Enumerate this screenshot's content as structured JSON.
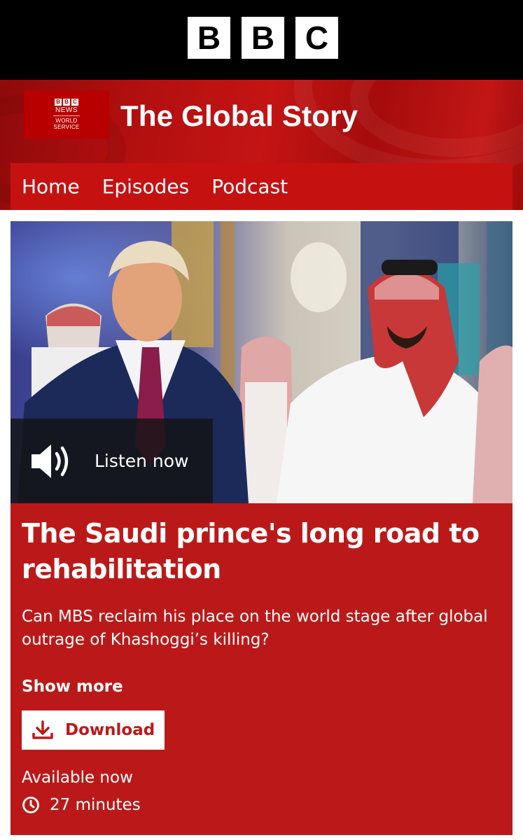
{
  "brand": {
    "bbc_letters": [
      "B",
      "B",
      "C"
    ],
    "news_logo": {
      "mini_letters": [
        "B",
        "B",
        "C"
      ],
      "news": "NEWS",
      "service_line1": "WORLD",
      "service_line2": "SERVICE"
    }
  },
  "header": {
    "title": "The Global Story"
  },
  "nav": {
    "items": [
      {
        "label": "Home"
      },
      {
        "label": "Episodes"
      },
      {
        "label": "Podcast"
      }
    ]
  },
  "hero": {
    "listen_label": "Listen now",
    "listen_icon": "speaker-icon"
  },
  "episode": {
    "title": "The Saudi prince's long road to rehabilitation",
    "description": "Can MBS reclaim his place on the world stage after global outrage of Khashoggi’s killing?",
    "show_more": "Show more",
    "download_label": "Download",
    "availability": "Available now",
    "duration": "27 minutes"
  },
  "colors": {
    "bbc_red": "#bb1919",
    "nav_red": "#c61111",
    "black": "#000000",
    "white": "#ffffff"
  }
}
